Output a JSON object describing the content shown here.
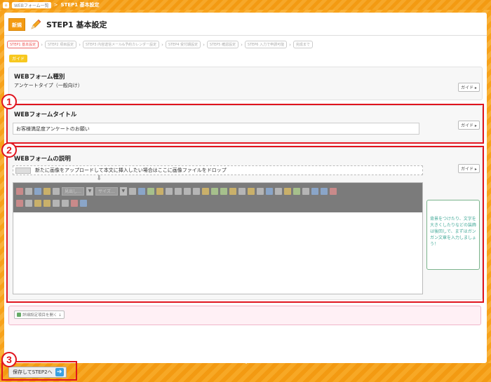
{
  "breadcrumb": {
    "link": "WEBフォーム一覧",
    "separator": ">",
    "current": "STEP1 基本設定"
  },
  "header": {
    "badge": "新規",
    "title": "STEP1 基本設定"
  },
  "steps": [
    {
      "label": "STEP1 基本設定",
      "active": true
    },
    {
      "label": "STEP2 項目設定",
      "active": false
    },
    {
      "label": "STEP3 内容送信メール&予約カレンダー設定",
      "active": false
    },
    {
      "label": "STEP4 受付期設定",
      "active": false
    },
    {
      "label": "STEP5 確認設定",
      "active": false
    },
    {
      "label": "STEP6 入力で申請可能",
      "active": false
    },
    {
      "label": "完成まで",
      "active": false
    }
  ],
  "guide_label": "ガイド",
  "guide_button": "ガイド ▸",
  "form_type": {
    "title": "WEBフォーム種別",
    "value": "アンケートタイプ（一般向け）"
  },
  "form_title": {
    "title": "WEBフォームタイトル",
    "value": "お客様満足度アンケートのお願い"
  },
  "form_description": {
    "title": "WEBフォームの説明",
    "upload_text": "新たに画像をアップロードして本文に挿入したい場合はここに画像ファイルをドロップ",
    "toolbar": {
      "format_select": "見出し…",
      "size_select": "サイズ…"
    },
    "editor_value": ""
  },
  "tip": {
    "text": "背景をつけたり、文字を大きくしたりなどの装飾は後回しで、まずはガンガン文章を入力しましょう！"
  },
  "detail_toggle": "詳細設定項目を開く ↓",
  "save_button": "保存してSTEP2へ",
  "callouts": [
    "1",
    "2",
    "3"
  ],
  "colors": {
    "accent_orange": "#f39a12",
    "highlight_red": "#e0141e",
    "tip_green": "#4a9"
  }
}
